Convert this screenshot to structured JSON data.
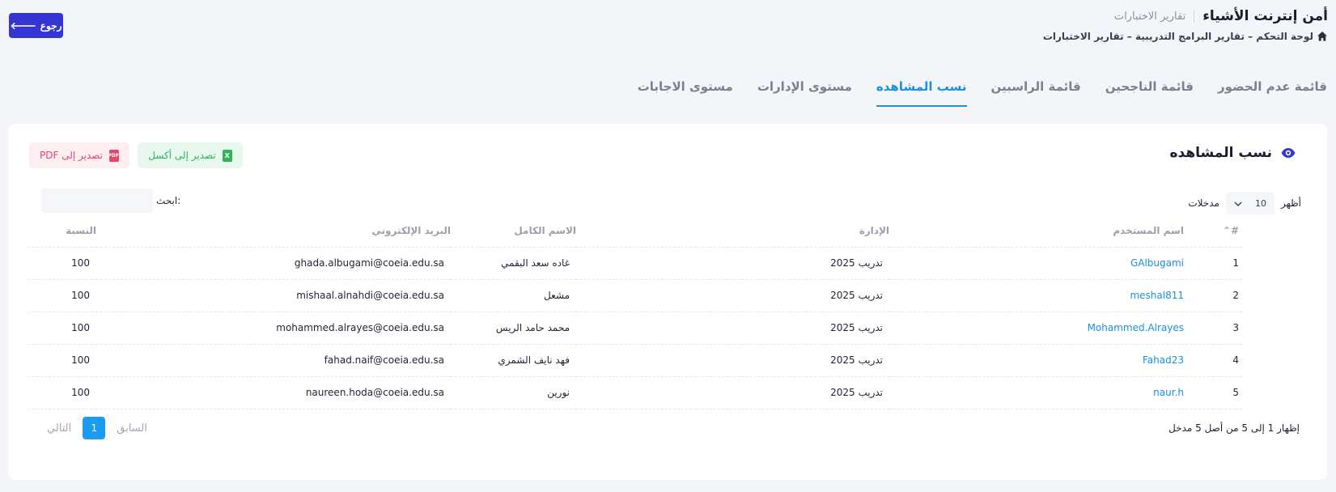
{
  "header": {
    "app_title": "أمن إنترنت الأشياء",
    "sub_title": "تقارير الاختبارات",
    "breadcrumb": "لوحة التحكم – تقارير البرامج التدريبية – تقارير الاختبارات",
    "back_label": "رجوع"
  },
  "tabs": [
    {
      "label": "قائمة عدم الحضور",
      "active": false
    },
    {
      "label": "قائمة الناجحين",
      "active": false
    },
    {
      "label": "قائمة الراسبين",
      "active": false
    },
    {
      "label": "نسب المشاهده",
      "active": true
    },
    {
      "label": "مستوى الإدارات",
      "active": false
    },
    {
      "label": "مستوى الاجابات",
      "active": false
    }
  ],
  "card": {
    "title": "نسب المشاهده",
    "export_excel": "تصدير إلى أكسل",
    "export_pdf": "تصدير إلى PDF",
    "show_label": "أظهر",
    "entries_label": "مدخلات",
    "page_length": "10",
    "search_label": "ابحث:",
    "search_value": ""
  },
  "table": {
    "columns": [
      "#",
      "اسم المستخدم",
      "الإدارة",
      "الاسم الكامل",
      "البريد الإلكتروني",
      "النسبة"
    ],
    "rows": [
      {
        "num": "1",
        "user": "GAlbugami",
        "dept": "تدريب 2025",
        "name": "غاده سعد البقمي",
        "email": "ghada.albugami@coeia.edu.sa",
        "pct": "100"
      },
      {
        "num": "2",
        "user": "meshal811",
        "dept": "تدريب 2025",
        "name": "مشعل",
        "email": "mishaal.alnahdi@coeia.edu.sa",
        "pct": "100"
      },
      {
        "num": "3",
        "user": "Mohammed.Alrayes",
        "dept": "تدريب 2025",
        "name": "محمد حامد الريس",
        "email": "mohammed.alrayes@coeia.edu.sa",
        "pct": "100"
      },
      {
        "num": "4",
        "user": "Fahad23",
        "dept": "تدريب 2025",
        "name": "فهد نايف الشمري",
        "email": "fahad.naif@coeia.edu.sa",
        "pct": "100"
      },
      {
        "num": "5",
        "user": "naur.h",
        "dept": "تدريب 2025",
        "name": "نورين",
        "email": "naureen.hoda@coeia.edu.sa",
        "pct": "100"
      }
    ]
  },
  "footer": {
    "info": "إظهار 1 إلى 5 من أصل 5 مدخل",
    "prev": "السابق",
    "page": "1",
    "next": "التالي"
  },
  "colors": {
    "primary_button": "#3535d4",
    "active_tab": "#1b8fe0",
    "link": "#1b8fe0",
    "pdf": "#e8456b",
    "excel": "#2fb45c"
  }
}
